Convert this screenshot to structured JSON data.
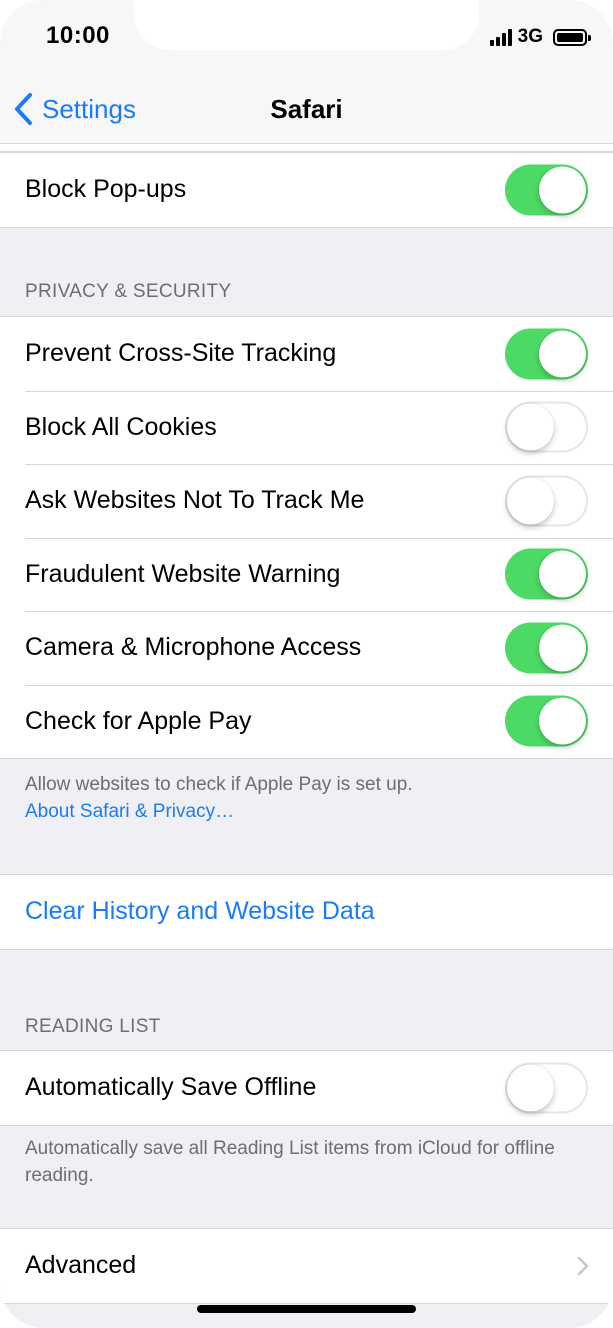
{
  "status_bar": {
    "time": "10:00",
    "network": "3G",
    "signal_icon": "cellular-signal-icon",
    "battery_icon": "battery-full-icon"
  },
  "nav": {
    "back_label": "Settings",
    "back_icon": "chevron-left-icon",
    "title": "Safari"
  },
  "block_popups": {
    "label": "Block Pop-ups",
    "on": true
  },
  "privacy": {
    "header": "PRIVACY & SECURITY",
    "items": [
      {
        "label": "Prevent Cross-Site Tracking",
        "on": true
      },
      {
        "label": "Block All Cookies",
        "on": false
      },
      {
        "label": "Ask Websites Not To Track Me",
        "on": false
      },
      {
        "label": "Fraudulent Website Warning",
        "on": true
      },
      {
        "label": "Camera & Microphone Access",
        "on": true
      },
      {
        "label": "Check for Apple Pay",
        "on": true
      }
    ],
    "footer_text": "Allow websites to check if Apple Pay is set up.",
    "footer_link": "About Safari & Privacy…"
  },
  "clear_history": {
    "label": "Clear History and Website Data"
  },
  "reading_list": {
    "header": "READING LIST",
    "item": {
      "label": "Automatically Save Offline",
      "on": false
    },
    "footer_text": "Automatically save all Reading List items from iCloud for offline reading."
  },
  "advanced": {
    "label": "Advanced",
    "chevron_icon": "chevron-right-icon"
  },
  "colors": {
    "toggle_on": "#4cd964",
    "link_blue": "#1a7cf5",
    "background": "#efeff4"
  }
}
